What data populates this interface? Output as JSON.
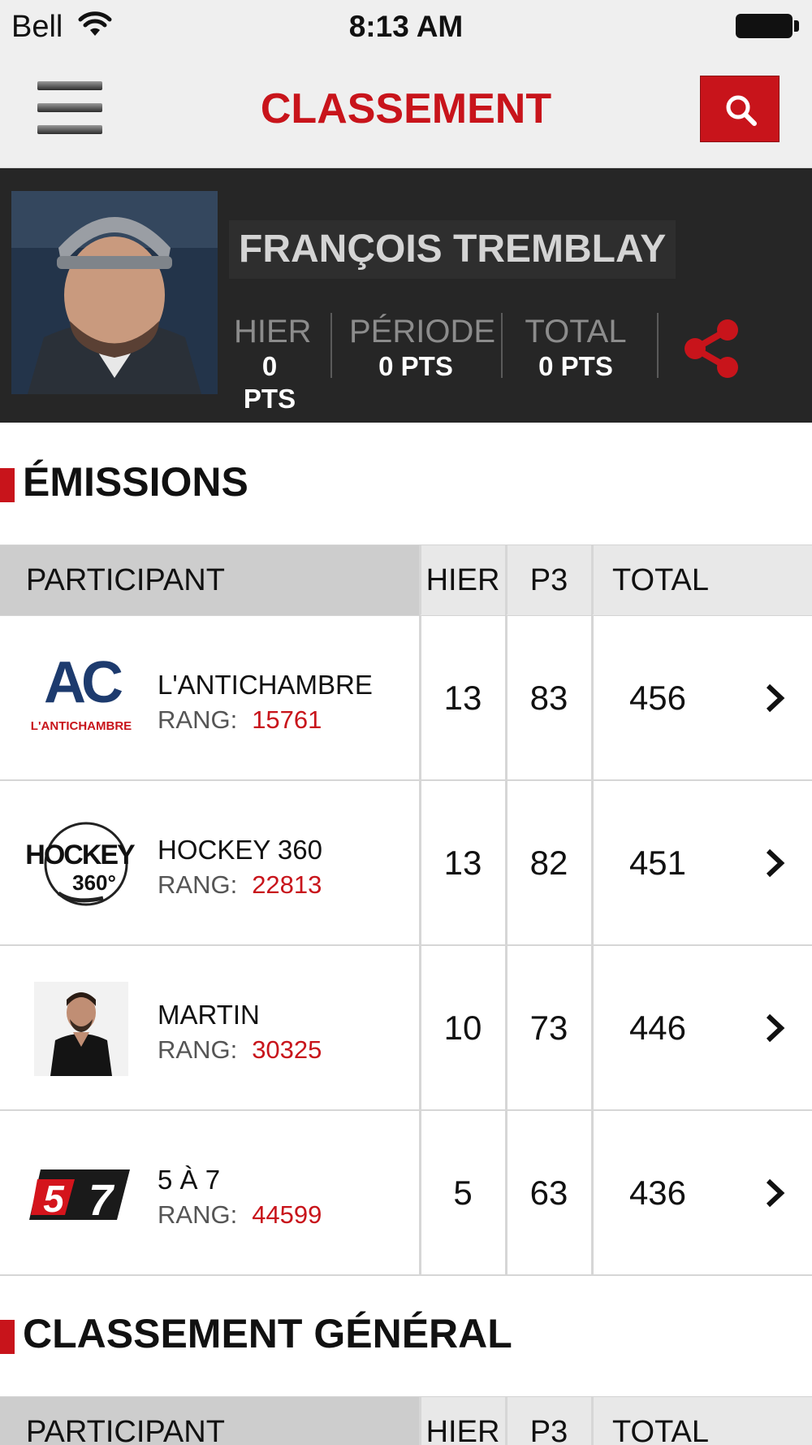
{
  "status_bar": {
    "carrier": "Bell",
    "time": "8:13 AM",
    "icons": [
      "wifi-icon",
      "battery-icon"
    ]
  },
  "header": {
    "title": "CLASSEMENT",
    "menu_icon": "hamburger-menu-icon",
    "search_icon": "search-icon"
  },
  "profile": {
    "name": "FRANÇOIS TREMBLAY",
    "stats": [
      {
        "label": "HIER",
        "value": "0 PTS"
      },
      {
        "label": "PÉRIODE",
        "value": "0 PTS"
      },
      {
        "label": "TOTAL",
        "value": "0 PTS"
      }
    ],
    "share_icon": "share-icon"
  },
  "emissions": {
    "title": "ÉMISSIONS",
    "columns": {
      "participant": "PARTICIPANT",
      "hier": "HIER",
      "p3": "P3",
      "total": "TOTAL"
    },
    "rang_label": "RANG:",
    "rows": [
      {
        "name": "L'ANTICHAMBRE",
        "rank": "15761",
        "hier": "13",
        "p3": "83",
        "total": "456",
        "logo_text_top": "AC",
        "logo_text_bottom": "L'ANTICHAMBRE"
      },
      {
        "name": "HOCKEY 360",
        "rank": "22813",
        "hier": "13",
        "p3": "82",
        "total": "451",
        "logo_text_top": "HOCKEY",
        "logo_text_bottom": "360°"
      },
      {
        "name": "MARTIN",
        "rank": "30325",
        "hier": "10",
        "p3": "73",
        "total": "446"
      },
      {
        "name": "5 À 7",
        "rank": "44599",
        "hier": "5",
        "p3": "63",
        "total": "436",
        "logo_text_top": "5",
        "logo_text_bottom": "7"
      }
    ]
  },
  "general": {
    "title": "CLASSEMENT GÉNÉRAL",
    "columns": {
      "participant": "PARTICIPANT",
      "hier": "HIER",
      "p3": "P3",
      "total": "TOTAL"
    }
  },
  "colors": {
    "accent": "#c8141b",
    "header_bg": "#efefef",
    "profile_bg": "#262626"
  }
}
